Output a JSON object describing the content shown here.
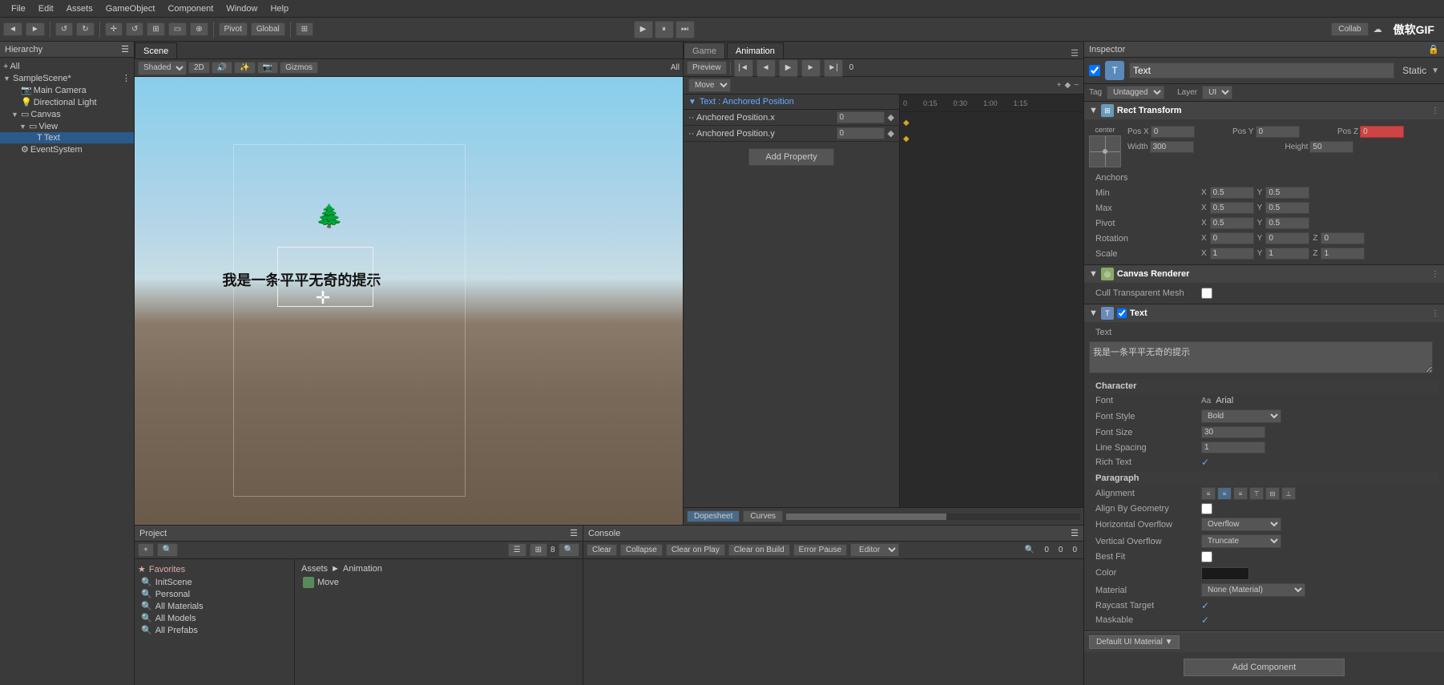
{
  "menubar": {
    "items": [
      "File",
      "Edit",
      "Assets",
      "GameObject",
      "Component",
      "Window",
      "Help"
    ]
  },
  "toolbar": {
    "pivot": "Pivot",
    "global": "Global",
    "collab": "Collab",
    "play_time": "0"
  },
  "hierarchy": {
    "title": "Hierarchy",
    "items": [
      {
        "label": "SampleScene*",
        "indent": 0,
        "arrow": "▼"
      },
      {
        "label": "Main Camera",
        "indent": 1,
        "arrow": ""
      },
      {
        "label": "Directional Light",
        "indent": 1,
        "arrow": ""
      },
      {
        "label": "Canvas",
        "indent": 1,
        "arrow": "▼"
      },
      {
        "label": "View",
        "indent": 2,
        "arrow": "▼"
      },
      {
        "label": "Text",
        "indent": 3,
        "arrow": ""
      },
      {
        "label": "EventSystem",
        "indent": 1,
        "arrow": ""
      }
    ]
  },
  "scene": {
    "tab_scene": "Scene",
    "tab_game": "Game",
    "shading_mode": "Shaded",
    "mode_2d": "2D",
    "gizmos": "Gizmos",
    "all": "All",
    "scene_text": "我是一条平平无奇的提示"
  },
  "animation": {
    "tab_game": "Game",
    "tab_animation": "Animation",
    "preview_label": "Preview",
    "move_label": "Move",
    "property_path": "Text : Anchored Position",
    "prop_x_label": "Anchored Position.x",
    "prop_y_label": "Anchored Position.y",
    "prop_x_value": "0",
    "prop_y_value": "0",
    "add_property_btn": "Add Property",
    "timeline_markers": [
      "0",
      "0:15",
      "0:30",
      "1:00",
      "1:15"
    ],
    "dopesheet_btn": "Dopesheet",
    "curves_btn": "Curves"
  },
  "inspector": {
    "title": "Inspector",
    "obj_name": "Text",
    "tag_label": "Tag",
    "tag_value": "Untagged",
    "layer_label": "Layer",
    "layer_value": "UI",
    "sections": {
      "rect_transform": {
        "title": "Rect Transform",
        "anchor_label": "center",
        "pos_x_label": "Pos X",
        "pos_x_value": "0",
        "pos_y_label": "Pos Y",
        "pos_y_value": "0",
        "pos_z_label": "Pos Z",
        "width_label": "Width",
        "width_value": "300",
        "height_label": "Height",
        "height_value": "50",
        "anchors_label": "Anchors",
        "min_label": "Min",
        "min_x": "0.5",
        "min_y": "0.5",
        "max_label": "Max",
        "max_x": "0.5",
        "max_y": "0.5",
        "pivot_label": "Pivot",
        "pivot_x": "0.5",
        "pivot_y": "0.5",
        "rotation_label": "Rotation",
        "rot_x": "0",
        "rot_y": "0",
        "rot_z": "0",
        "scale_label": "Scale",
        "scale_x": "1",
        "scale_y": "1",
        "scale_z": "1"
      },
      "canvas_renderer": {
        "title": "Canvas Renderer",
        "cull_label": "Cull Transparent Mesh"
      },
      "text_component": {
        "title": "Text",
        "text_label": "Text",
        "text_value": "我是一条平平无奇的提示",
        "character_label": "Character",
        "font_label": "Font",
        "font_value": "Arial",
        "font_style_label": "Font Style",
        "font_style_value": "Bold",
        "font_size_label": "Font Size",
        "font_size_value": "30",
        "line_spacing_label": "Line Spacing",
        "line_spacing_value": "1",
        "rich_text_label": "Rich Text",
        "paragraph_label": "Paragraph",
        "alignment_label": "Alignment",
        "align_by_geometry_label": "Align By Geometry",
        "horiz_overflow_label": "Horizontal Overflow",
        "horiz_overflow_value": "Overflow",
        "vert_overflow_label": "Vertical Overflow",
        "vert_overflow_value": "Truncate",
        "best_fit_label": "Best Fit",
        "color_label": "Color",
        "material_label": "Material",
        "material_value": "None (Material)",
        "raycast_label": "Raycast Target",
        "maskable_label": "Maskable"
      }
    }
  },
  "project": {
    "title": "Project",
    "favorites_label": "Favorites",
    "items": [
      "InitScene",
      "Personal",
      "All Materials",
      "All Models",
      "All Prefabs"
    ],
    "breadcrumb_assets": "Assets",
    "breadcrumb_sep": "►",
    "breadcrumb_anim": "Animation",
    "asset_name": "Move"
  },
  "console": {
    "title": "Console",
    "clear_btn": "Clear",
    "collapse_btn": "Collapse",
    "clear_on_play_btn": "Clear on Play",
    "clear_on_build_btn": "Clear on Build",
    "error_pause_btn": "Error Pause",
    "editor_label": "Editor",
    "count0_1": "0",
    "count0_2": "0",
    "count0_3": "0"
  },
  "logo": "傲软GIF"
}
